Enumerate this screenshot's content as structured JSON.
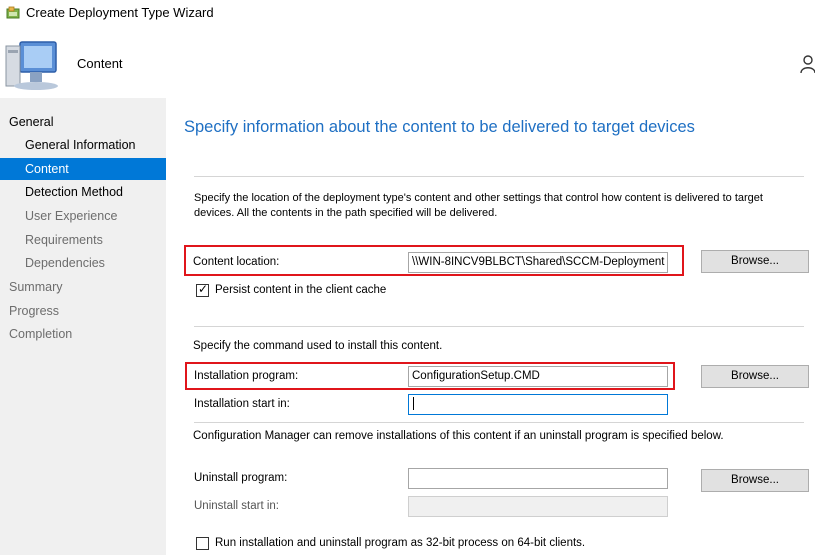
{
  "window": {
    "title": "Create Deployment Type Wizard"
  },
  "header": {
    "page_name": "Content"
  },
  "sidebar": {
    "items": [
      {
        "label": "General"
      },
      {
        "label": "General Information"
      },
      {
        "label": "Content"
      },
      {
        "label": "Detection Method"
      },
      {
        "label": "User Experience"
      },
      {
        "label": "Requirements"
      },
      {
        "label": "Dependencies"
      },
      {
        "label": "Summary"
      },
      {
        "label": "Progress"
      },
      {
        "label": "Completion"
      }
    ]
  },
  "main": {
    "heading": "Specify information about the content to be delivered to target devices",
    "description": "Specify the location of the deployment type's content and other settings that control how content is delivered to target devices. All the contents in the path specified will be delivered.",
    "content_location": {
      "label": "Content location:",
      "value": "\\\\WIN-8INCV9BLBCT\\Shared\\SCCM-Deployment",
      "browse": "Browse..."
    },
    "persist_cache": {
      "label": "Persist content in the client cache",
      "checked": true
    },
    "command_intro": "Specify the command used to install this content.",
    "install_program": {
      "label": "Installation program:",
      "value": "ConfigurationSetup.CMD",
      "browse": "Browse..."
    },
    "install_start_in": {
      "label": "Installation start in:",
      "value": ""
    },
    "uninstall_note": "Configuration Manager can remove installations of this content if an uninstall program is specified below.",
    "uninstall_program": {
      "label": "Uninstall program:",
      "value": "",
      "browse": "Browse..."
    },
    "uninstall_start_in": {
      "label": "Uninstall start in:",
      "value": ""
    },
    "run_32bit": {
      "label": "Run installation and uninstall program as 32-bit process on 64-bit clients.",
      "checked": false
    }
  },
  "colors": {
    "accent": "#0078d7",
    "heading": "#1e6fc3",
    "highlight": "#e0151b",
    "sidebar_bg": "#f0f0f0"
  }
}
